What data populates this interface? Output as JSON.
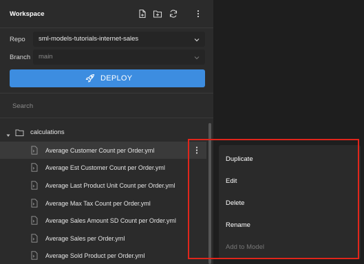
{
  "workspace": {
    "title": "Workspace"
  },
  "header_icons": [
    "new-file-icon",
    "new-folder-icon",
    "refresh-icon",
    "more-vertical-icon"
  ],
  "repo": {
    "label": "Repo",
    "value": "sml-models-tutorials-internet-sales"
  },
  "branch": {
    "label": "Branch",
    "value": "main"
  },
  "deploy": {
    "label": "DEPLOY",
    "icon": "rocket-icon",
    "color": "#3d8de0"
  },
  "search": {
    "placeholder": "Search"
  },
  "tree": {
    "folder": "calculations",
    "files": [
      "Average Customer Count per Order.yml",
      "Average Est Customer Count per Order.yml",
      "Average Last Product Unit Count per Order.yml",
      "Average Max Tax Count per Order.yml",
      "Average Sales Amount SD Count per Order.yml",
      "Average Sales per Order.yml",
      "Average Sold Product per Order.yml"
    ]
  },
  "context_menu": {
    "items": [
      "Duplicate",
      "Edit",
      "Delete",
      "Rename",
      "Add to Model"
    ],
    "disabled_item": "Add to Model"
  },
  "highlight_color": "#e0251b"
}
